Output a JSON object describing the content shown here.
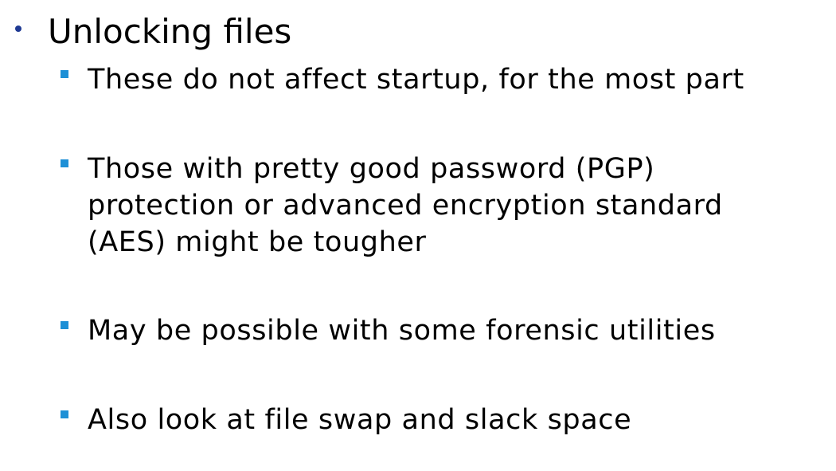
{
  "slide": {
    "heading": "Unlocking files",
    "bullets": [
      "These do not affect startup, for the most part",
      "Those with pretty good password (PGP)\nprotection or advanced encryption standard\n(AES) might be tougher",
      "May be possible with some forensic utilities",
      "Also look at file swap and slack space"
    ]
  },
  "colors": {
    "level1_bullet": "#1f3a93",
    "level2_bullet": "#1e90d6",
    "text": "#000000",
    "background": "#ffffff"
  }
}
